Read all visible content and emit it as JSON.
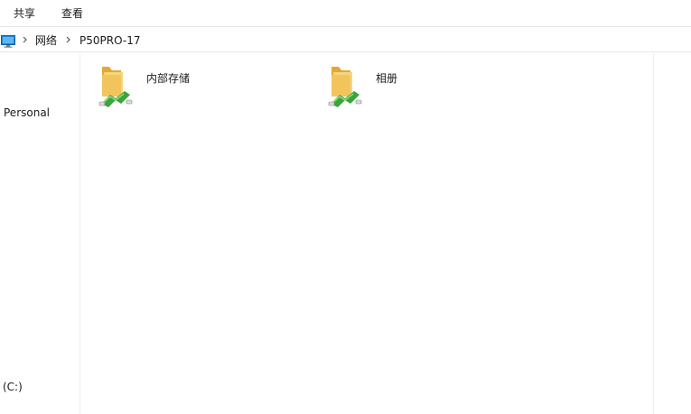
{
  "ribbon": {
    "tabs": [
      {
        "label": "共享"
      },
      {
        "label": "查看"
      }
    ]
  },
  "address": {
    "computer_icon": "computer-icon",
    "breadcrumbs": [
      {
        "label": "网络"
      },
      {
        "label": "P50PRO-17"
      }
    ]
  },
  "navigation": {
    "items": [
      {
        "label": "Personal"
      },
      {
        "label": "(C:)"
      }
    ]
  },
  "content": {
    "items": [
      {
        "label": "内部存储",
        "icon": "network-folder-icon"
      },
      {
        "label": "相册",
        "icon": "network-folder-icon"
      }
    ]
  },
  "colors": {
    "folder_yellow": "#f2c55c",
    "share_green": "#3aa63a",
    "divider": "#e6e6e6"
  }
}
